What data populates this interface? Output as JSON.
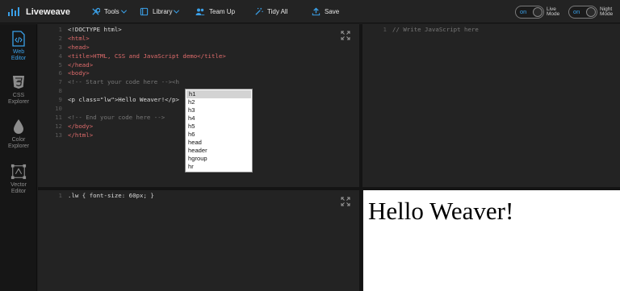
{
  "topbar": {
    "brand": "Liveweave",
    "tools": "Tools",
    "library": "Library",
    "team_up": "Team Up",
    "tidy_all": "Tidy All",
    "save": "Save",
    "live_mode": {
      "state": "on",
      "label": "Live Mode"
    },
    "night_mode": {
      "state": "on",
      "label": "Night Mode"
    }
  },
  "sidebar": {
    "items": [
      {
        "label": "Web Editor",
        "icon": "code-icon",
        "active": true
      },
      {
        "label": "CSS Explorer",
        "icon": "css3-icon",
        "active": false
      },
      {
        "label": "Color Explorer",
        "icon": "drop-icon",
        "active": false
      },
      {
        "label": "Vector Editor",
        "icon": "vector-icon",
        "active": false
      }
    ]
  },
  "html_editor": {
    "lines": [
      {
        "n": "1",
        "t": "<!DOCTYPE html>"
      },
      {
        "n": "2",
        "t": "<html>"
      },
      {
        "n": "3",
        "t": "<head>"
      },
      {
        "n": "4",
        "t": "<title>HTML, CSS and JavaScript demo</title>"
      },
      {
        "n": "5",
        "t": "</head>"
      },
      {
        "n": "6",
        "t": "<body>"
      },
      {
        "n": "7",
        "t": "<!-- Start your code here --><h"
      },
      {
        "n": "8",
        "t": ""
      },
      {
        "n": "9",
        "t": "<p class=\"lw\">Hello Weaver!</p>"
      },
      {
        "n": "10",
        "t": ""
      },
      {
        "n": "11",
        "t": "<!-- End your code here -->"
      },
      {
        "n": "12",
        "t": "</body>"
      },
      {
        "n": "13",
        "t": "</html>"
      }
    ]
  },
  "autocomplete": {
    "options": [
      "h1",
      "h2",
      "h3",
      "h4",
      "h5",
      "h6",
      "head",
      "header",
      "hgroup",
      "hr"
    ],
    "selected": "h1"
  },
  "js_editor": {
    "lines": [
      {
        "n": "1",
        "t": "// Write JavaScript here"
      }
    ]
  },
  "css_editor": {
    "lines": [
      {
        "n": "1",
        "t": ".lw { font-size: 60px; }"
      }
    ]
  },
  "output": {
    "text": "Hello Weaver!"
  },
  "colors": {
    "accent": "#3aa0e8",
    "background": "#1e1e1e",
    "panel": "#232323",
    "tag": "#e06c6c",
    "comment": "#777777",
    "attr_value": "#e6c07b"
  }
}
